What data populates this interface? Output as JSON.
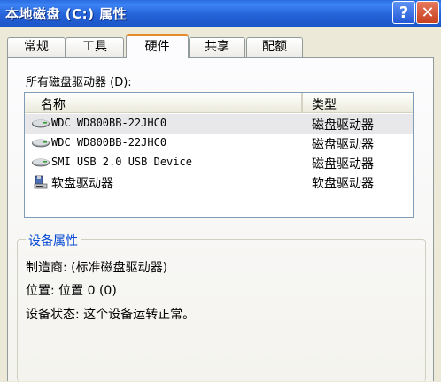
{
  "window": {
    "title": "本地磁盘 (C:) 属性",
    "help_label": "?",
    "close_label": "✕"
  },
  "tabs": [
    {
      "label": "常规",
      "active": false
    },
    {
      "label": "工具",
      "active": false
    },
    {
      "label": "硬件",
      "active": true
    },
    {
      "label": "共享",
      "active": false
    },
    {
      "label": "配额",
      "active": false
    }
  ],
  "hardware": {
    "list_label": "所有磁盘驱动器 (D):",
    "columns": {
      "name": "名称",
      "type": "类型"
    },
    "devices": [
      {
        "name": "WDC WD800BB-22JHC0",
        "type": "磁盘驱动器",
        "icon": "hard-disk-icon",
        "selected": true
      },
      {
        "name": "WDC WD800BB-22JHC0",
        "type": "磁盘驱动器",
        "icon": "hard-disk-icon",
        "selected": false
      },
      {
        "name": "SMI USB 2.0 USB Device",
        "type": "磁盘驱动器",
        "icon": "hard-disk-icon",
        "selected": false
      },
      {
        "name": "软盘驱动器",
        "type": "软盘驱动器",
        "icon": "floppy-drive-icon",
        "selected": false
      }
    ],
    "properties": {
      "group_title": "设备属性",
      "manufacturer": "制造商: (标准磁盘驱动器)",
      "location": "位置: 位置 0 (0)",
      "status": "设备状态: 这个设备运转正常。"
    }
  },
  "colors": {
    "titlebar": "#2563D9",
    "active_tab_accent": "#E68B2C",
    "group_title": "#0046D5",
    "panel": "#FCFCFE"
  }
}
